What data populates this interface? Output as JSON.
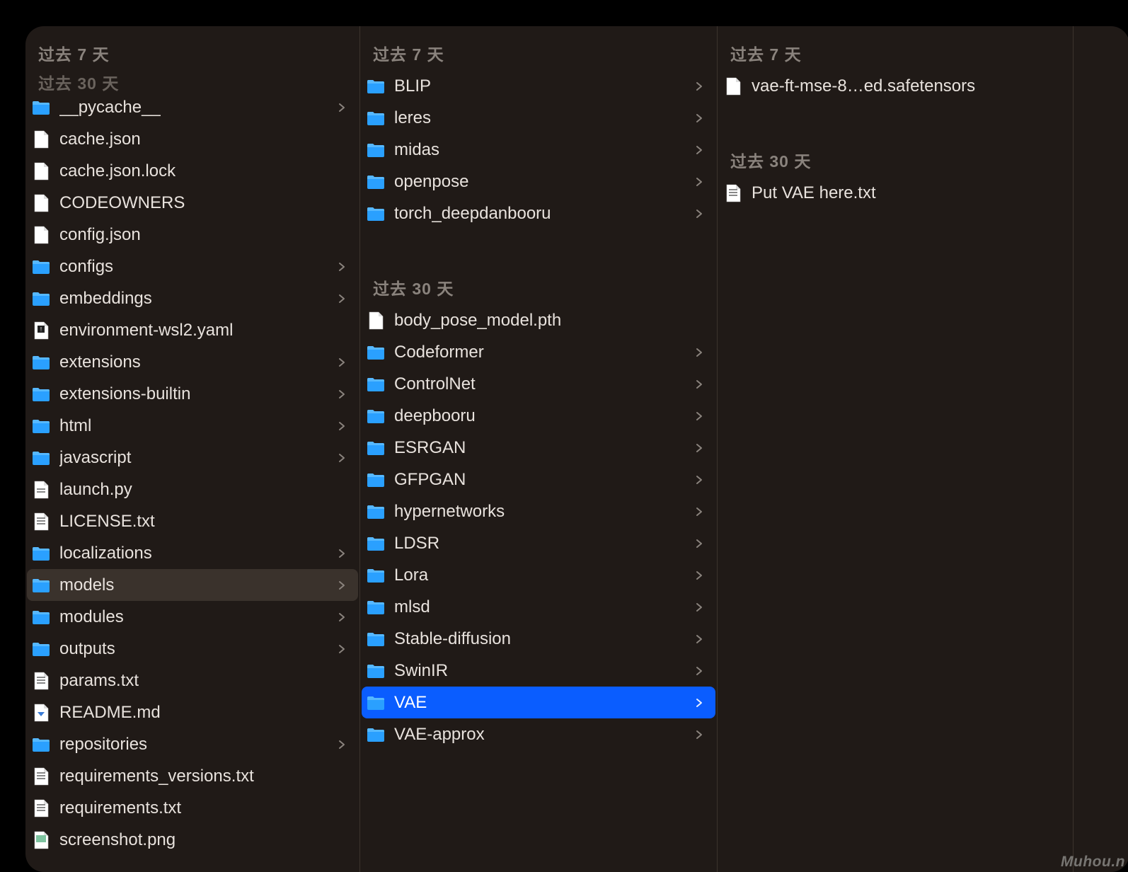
{
  "headers": {
    "past7": "过去 7 天",
    "past30": "过去 30 天"
  },
  "column1": {
    "clipped_header": "过去 30 天",
    "items": [
      {
        "name": "__pycache__",
        "type": "folder",
        "expandable": true
      },
      {
        "name": "cache.json",
        "type": "file"
      },
      {
        "name": "cache.json.lock",
        "type": "file"
      },
      {
        "name": "CODEOWNERS",
        "type": "file"
      },
      {
        "name": "config.json",
        "type": "file"
      },
      {
        "name": "configs",
        "type": "folder",
        "expandable": true
      },
      {
        "name": "embeddings",
        "type": "folder",
        "expandable": true
      },
      {
        "name": "environment-wsl2.yaml",
        "type": "yaml"
      },
      {
        "name": "extensions",
        "type": "folder",
        "expandable": true
      },
      {
        "name": "extensions-builtin",
        "type": "folder",
        "expandable": true
      },
      {
        "name": "html",
        "type": "folder",
        "expandable": true
      },
      {
        "name": "javascript",
        "type": "folder",
        "expandable": true
      },
      {
        "name": "launch.py",
        "type": "py"
      },
      {
        "name": "LICENSE.txt",
        "type": "txt"
      },
      {
        "name": "localizations",
        "type": "folder",
        "expandable": true
      },
      {
        "name": "models",
        "type": "folder",
        "expandable": true,
        "selected": true
      },
      {
        "name": "modules",
        "type": "folder",
        "expandable": true
      },
      {
        "name": "outputs",
        "type": "folder",
        "expandable": true
      },
      {
        "name": "params.txt",
        "type": "txt"
      },
      {
        "name": "README.md",
        "type": "md"
      },
      {
        "name": "repositories",
        "type": "folder",
        "expandable": true
      },
      {
        "name": "requirements_versions.txt",
        "type": "txt"
      },
      {
        "name": "requirements.txt",
        "type": "txt"
      },
      {
        "name": "screenshot.png",
        "type": "img"
      }
    ]
  },
  "column2": {
    "group7": [
      {
        "name": "BLIP",
        "type": "folder",
        "expandable": true
      },
      {
        "name": "leres",
        "type": "folder",
        "expandable": true
      },
      {
        "name": "midas",
        "type": "folder",
        "expandable": true
      },
      {
        "name": "openpose",
        "type": "folder",
        "expandable": true
      },
      {
        "name": "torch_deepdanbooru",
        "type": "folder",
        "expandable": true
      }
    ],
    "group30": [
      {
        "name": "body_pose_model.pth",
        "type": "file"
      },
      {
        "name": "Codeformer",
        "type": "folder",
        "expandable": true
      },
      {
        "name": "ControlNet",
        "type": "folder",
        "expandable": true
      },
      {
        "name": "deepbooru",
        "type": "folder",
        "expandable": true
      },
      {
        "name": "ESRGAN",
        "type": "folder",
        "expandable": true
      },
      {
        "name": "GFPGAN",
        "type": "folder",
        "expandable": true
      },
      {
        "name": "hypernetworks",
        "type": "folder",
        "expandable": true
      },
      {
        "name": "LDSR",
        "type": "folder",
        "expandable": true
      },
      {
        "name": "Lora",
        "type": "folder",
        "expandable": true
      },
      {
        "name": "mlsd",
        "type": "folder",
        "expandable": true
      },
      {
        "name": "Stable-diffusion",
        "type": "folder",
        "expandable": true
      },
      {
        "name": "SwinIR",
        "type": "folder",
        "expandable": true
      },
      {
        "name": "VAE",
        "type": "folder",
        "expandable": true,
        "active": true
      },
      {
        "name": "VAE-approx",
        "type": "folder",
        "expandable": true
      }
    ]
  },
  "column3": {
    "group7": [
      {
        "name": "vae-ft-mse-8…ed.safetensors",
        "type": "file"
      }
    ],
    "group30": [
      {
        "name": "Put VAE here.txt",
        "type": "txt"
      }
    ]
  },
  "watermark": "Muhou.n"
}
